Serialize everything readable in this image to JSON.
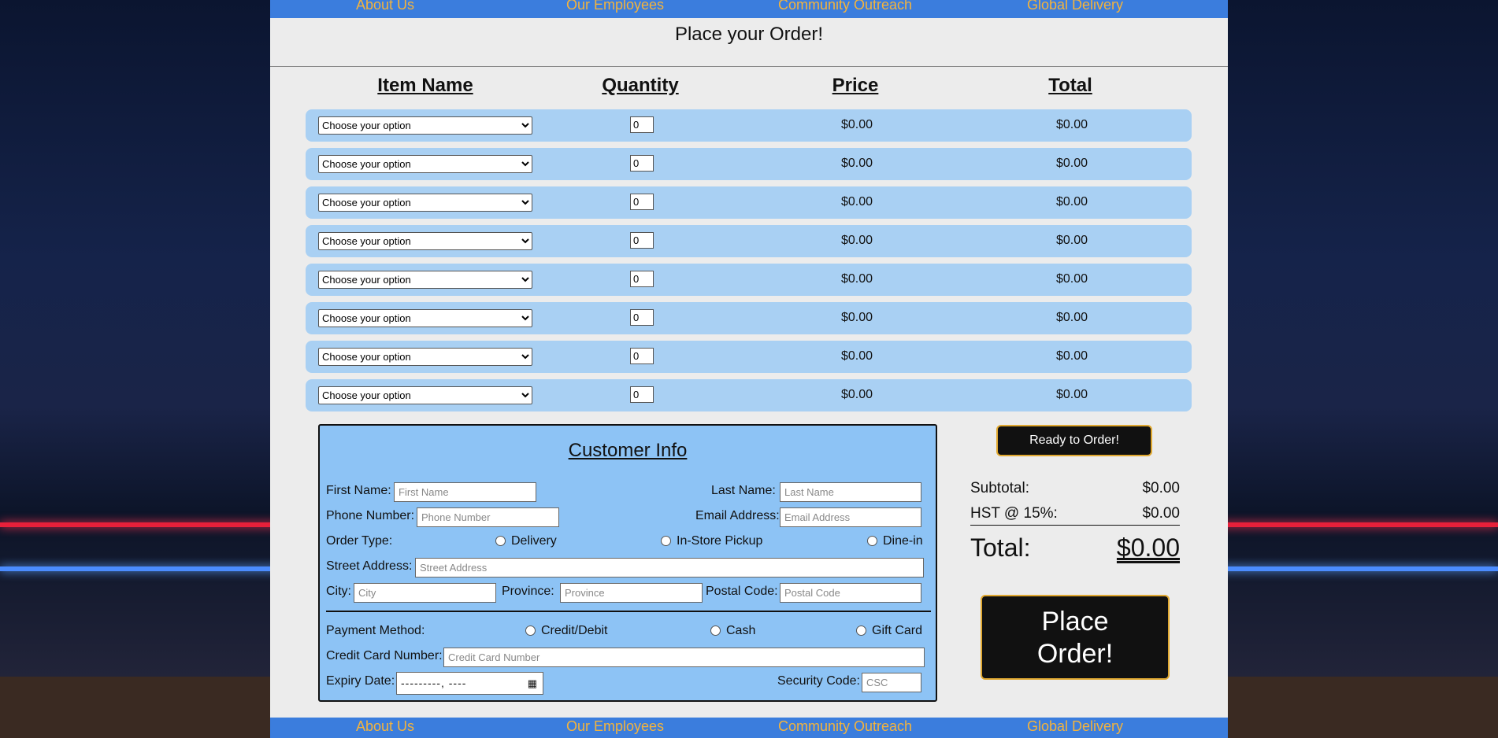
{
  "nav": {
    "items": [
      "About Us",
      "Our Employees",
      "Community Outreach",
      "Global Delivery"
    ]
  },
  "page": {
    "title": "Place your Order!"
  },
  "order_table": {
    "headers": [
      "Item Name",
      "Quantity",
      "Price",
      "Total"
    ],
    "rows": [
      {
        "item": "Choose your option",
        "quantity": "0",
        "price": "$0.00",
        "total": "$0.00"
      },
      {
        "item": "Choose your option",
        "quantity": "0",
        "price": "$0.00",
        "total": "$0.00"
      },
      {
        "item": "Choose your option",
        "quantity": "0",
        "price": "$0.00",
        "total": "$0.00"
      },
      {
        "item": "Choose your option",
        "quantity": "0",
        "price": "$0.00",
        "total": "$0.00"
      },
      {
        "item": "Choose your option",
        "quantity": "0",
        "price": "$0.00",
        "total": "$0.00"
      },
      {
        "item": "Choose your option",
        "quantity": "0",
        "price": "$0.00",
        "total": "$0.00"
      },
      {
        "item": "Choose your option",
        "quantity": "0",
        "price": "$0.00",
        "total": "$0.00"
      },
      {
        "item": "Choose your option",
        "quantity": "0",
        "price": "$0.00",
        "total": "$0.00"
      }
    ]
  },
  "customer": {
    "title": "Customer Info",
    "first_name": {
      "label": "First Name:",
      "placeholder": "First Name"
    },
    "last_name": {
      "label": "Last Name:",
      "placeholder": "Last Name"
    },
    "phone": {
      "label": "Phone Number:",
      "placeholder": "Phone Number"
    },
    "email": {
      "label": "Email Address:",
      "placeholder": "Email Address"
    },
    "order_type": {
      "label": "Order Type:",
      "options": [
        "Delivery",
        "In-Store Pickup",
        "Dine-in"
      ]
    },
    "street": {
      "label": "Street Address:",
      "placeholder": "Street Address"
    },
    "city": {
      "label": "City:",
      "placeholder": "City"
    },
    "province": {
      "label": "Province:",
      "placeholder": "Province"
    },
    "postal": {
      "label": "Postal Code:",
      "placeholder": "Postal Code"
    },
    "payment": {
      "label": "Payment Method:",
      "options": [
        "Credit/Debit",
        "Cash",
        "Gift Card"
      ]
    },
    "card": {
      "label": "Credit Card Number:",
      "placeholder": "Credit Card Number"
    },
    "expiry": {
      "label": "Expiry Date:",
      "value": "---------, ----"
    },
    "csc": {
      "label": "Security Code:",
      "placeholder": "CSC"
    }
  },
  "summary": {
    "ready_label": "Ready to Order!",
    "subtotal_label": "Subtotal:",
    "subtotal": "$0.00",
    "hst_label": "HST @ 15%:",
    "hst": "$0.00",
    "total_label": "Total:",
    "total": "$0.00",
    "place_label_1": "Place",
    "place_label_2": "Order!"
  },
  "colors": {
    "nav": "#3b7ddd",
    "nav_text": "#f3b33d",
    "row": "#a9d0f3",
    "customer_panel": "#8dc3f5",
    "button": "#111111",
    "button_border": "#e0a830"
  }
}
